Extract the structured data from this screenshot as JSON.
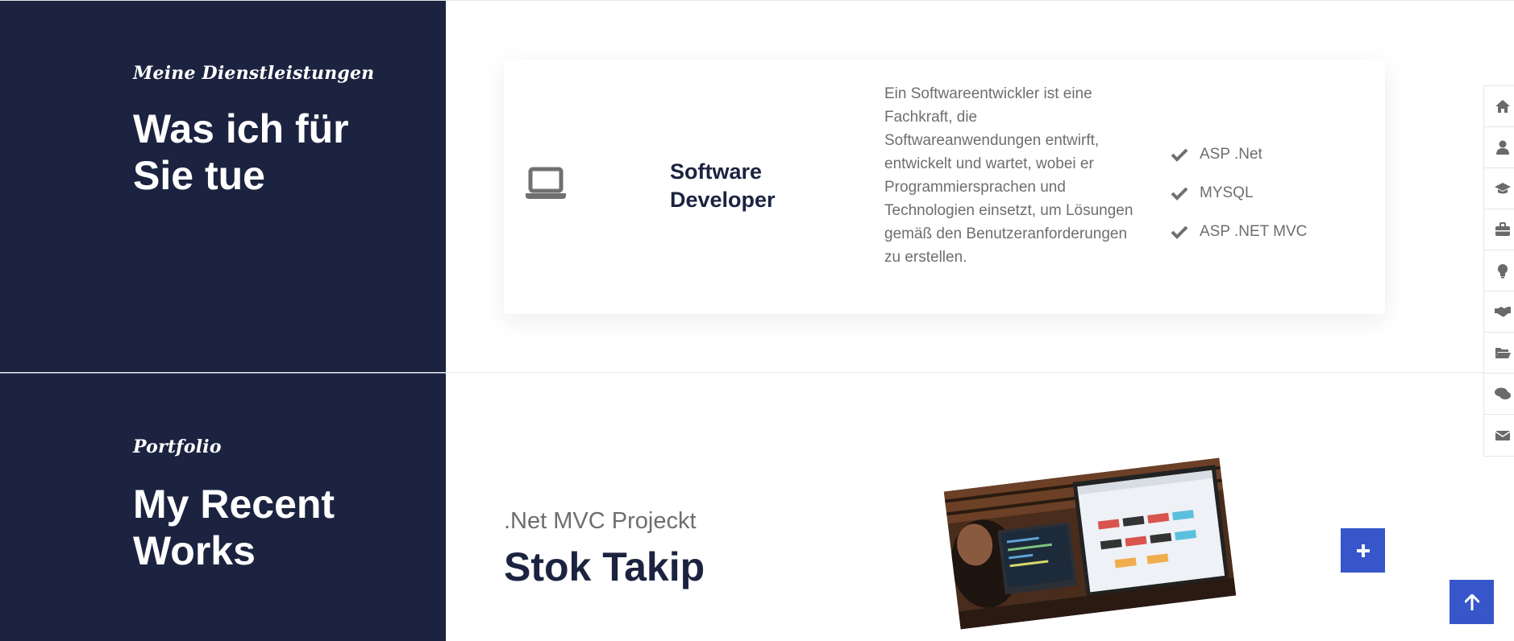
{
  "services": {
    "subtitle": "Meine Dienstleistungen",
    "heading": "Was ich für Sie tue",
    "card": {
      "icon": "laptop-icon",
      "title": "Software Developer",
      "description": "Ein Softwareentwickler ist eine Fachkraft, die Softwareanwendungen entwirft, entwickelt und wartet, wobei er Programmiersprachen und Technologien einsetzt, um Lösungen gemäß den Benutzeranforderungen zu erstellen.",
      "features": [
        "ASP .Net",
        "MYSQL",
        "ASP .NET MVC"
      ]
    }
  },
  "portfolio": {
    "subtitle": "Portfolio",
    "heading": "My Recent Works",
    "item": {
      "category": ".Net MVC Projeckt",
      "title": "Stok Takip",
      "image_icon": "project-screenshot-image"
    }
  },
  "side_nav": {
    "items": [
      "home-icon",
      "user-icon",
      "graduation-cap-icon",
      "briefcase-icon",
      "lightbulb-icon",
      "handshake-icon",
      "folder-open-icon",
      "comments-icon",
      "envelope-icon"
    ]
  },
  "colors": {
    "panel_bg": "#1b2340",
    "accent": "#3656c9",
    "text_muted": "#6e6e6e",
    "text_dark": "#1b2340"
  }
}
